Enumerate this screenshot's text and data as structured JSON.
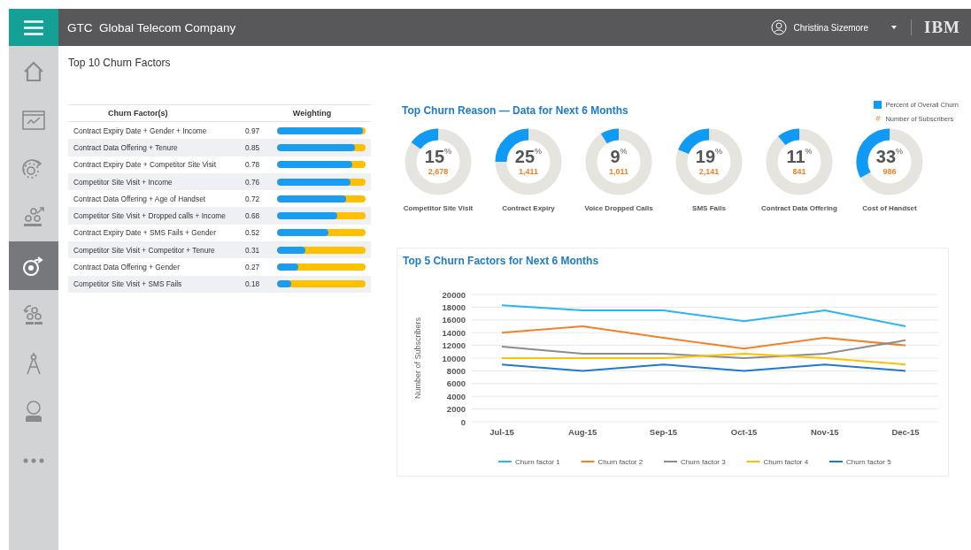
{
  "header": {
    "company": "GTC  Global Telecom Company",
    "user": "Christina Sizemore",
    "logo": "IBM"
  },
  "sidebar": {
    "items": [
      {
        "kind": "home",
        "selected": false
      },
      {
        "kind": "window",
        "selected": false
      },
      {
        "kind": "gear",
        "selected": false
      },
      {
        "kind": "people",
        "selected": false
      },
      {
        "kind": "target",
        "selected": true
      },
      {
        "kind": "cycle",
        "selected": false
      },
      {
        "kind": "compass",
        "selected": false
      },
      {
        "kind": "user",
        "selected": false
      },
      {
        "kind": "more",
        "selected": false
      }
    ]
  },
  "page_title": "Top 10 Churn Factors",
  "factors_table": {
    "columns": [
      "Churn Factor(s)",
      "Weighting"
    ],
    "rows": [
      {
        "factor": "Contract Expiry Date + Gender + Income",
        "weight": "0.97",
        "level": 0.97
      },
      {
        "factor": "Contract Data Offering + Tenure",
        "weight": "0.85",
        "level": 0.88
      },
      {
        "factor": "Contract Expiry Date + Competitor Site Visit",
        "weight": "0.78",
        "level": 0.85
      },
      {
        "factor": "Competitor Site Visit + Income",
        "weight": "0.76",
        "level": 0.83
      },
      {
        "factor": "Contract Data Offering + Age of Handset",
        "weight": "0.72",
        "level": 0.78
      },
      {
        "factor": "Competitor Site Visit + Dropped calls + Income",
        "weight": "0.68",
        "level": 0.68
      },
      {
        "factor": "Contract Expiry Date + SMS Fails + Gender",
        "weight": "0.52",
        "level": 0.58
      },
      {
        "factor": "Competitor Site Visit + Competitor + Tenure",
        "weight": "0.31",
        "level": 0.32
      },
      {
        "factor": "Contract Data Offering + Gender",
        "weight": "0.27",
        "level": 0.24
      },
      {
        "factor": "Competitor Site Visit + SMS Fails",
        "weight": "0.18",
        "level": 0.16
      }
    ]
  },
  "churn_reasons": {
    "title": "Top Churn Reason — Data for Next 6 Months",
    "legend": {
      "percent_label": "Percent of Overall Churn",
      "count_symbol": "#",
      "count_label": "Number of Subscribers"
    },
    "items": [
      {
        "percent": "15$^{%}$",
        "count": "2,678",
        "label": "Competitor Site Visit",
        "level": 0.15
      },
      {
        "percent": "25$^{%}$",
        "count": "1,411",
        "label": "Contract Expiry",
        "level": 0.25
      },
      {
        "percent": "9$^{%}$",
        "count": "1,011",
        "label": "Voice Dropped Calls",
        "level": 0.09
      },
      {
        "percent": "19$^{%}$",
        "count": "2,141",
        "label": "SMS Fails",
        "level": 0.19
      },
      {
        "percent": "11$^{%}$",
        "count": "841",
        "label": "Contract Data Offering",
        "level": 0.11
      },
      {
        "percent": "33$^{%}$",
        "count": "986",
        "label": "Cost of Handset",
        "level": 0.33
      }
    ]
  },
  "trend": {
    "chart_data": {
      "type": "line",
      "title": "Top 5 Churn Factors for Next 6 Months",
      "ylabel": "Number of Subscribers",
      "categories": [
        "Jul-15",
        "Aug-15",
        "Sep-15",
        "Oct-15",
        "Nov-15",
        "Dec-15"
      ],
      "ylim": [
        0,
        20000
      ],
      "grid": true,
      "legend": true,
      "yticks": [
        0,
        2000,
        4000,
        6000,
        8000,
        10000,
        12000,
        14000,
        16000,
        18000,
        20000
      ],
      "series": [
        {
          "name": "Churn factor 1",
          "color": "#29b5ef",
          "values": [
            18300,
            17500,
            17500,
            15800,
            17500,
            15000
          ]
        },
        {
          "name": "Churn factor 2",
          "color": "#f58025",
          "values": [
            14000,
            15000,
            13200,
            11500,
            13200,
            12000
          ]
        },
        {
          "name": "Churn factor 3",
          "color": "#8c8c8c",
          "values": [
            11800,
            10700,
            10700,
            10000,
            10700,
            12800
          ]
        },
        {
          "name": "Churn factor 4",
          "color": "#ffc000",
          "values": [
            10000,
            10000,
            10000,
            10700,
            10000,
            9000
          ]
        },
        {
          "name": "Churn factor 5",
          "color": "#1f78d1",
          "values": [
            9000,
            8000,
            9000,
            8000,
            9000,
            8000
          ]
        }
      ]
    }
  }
}
